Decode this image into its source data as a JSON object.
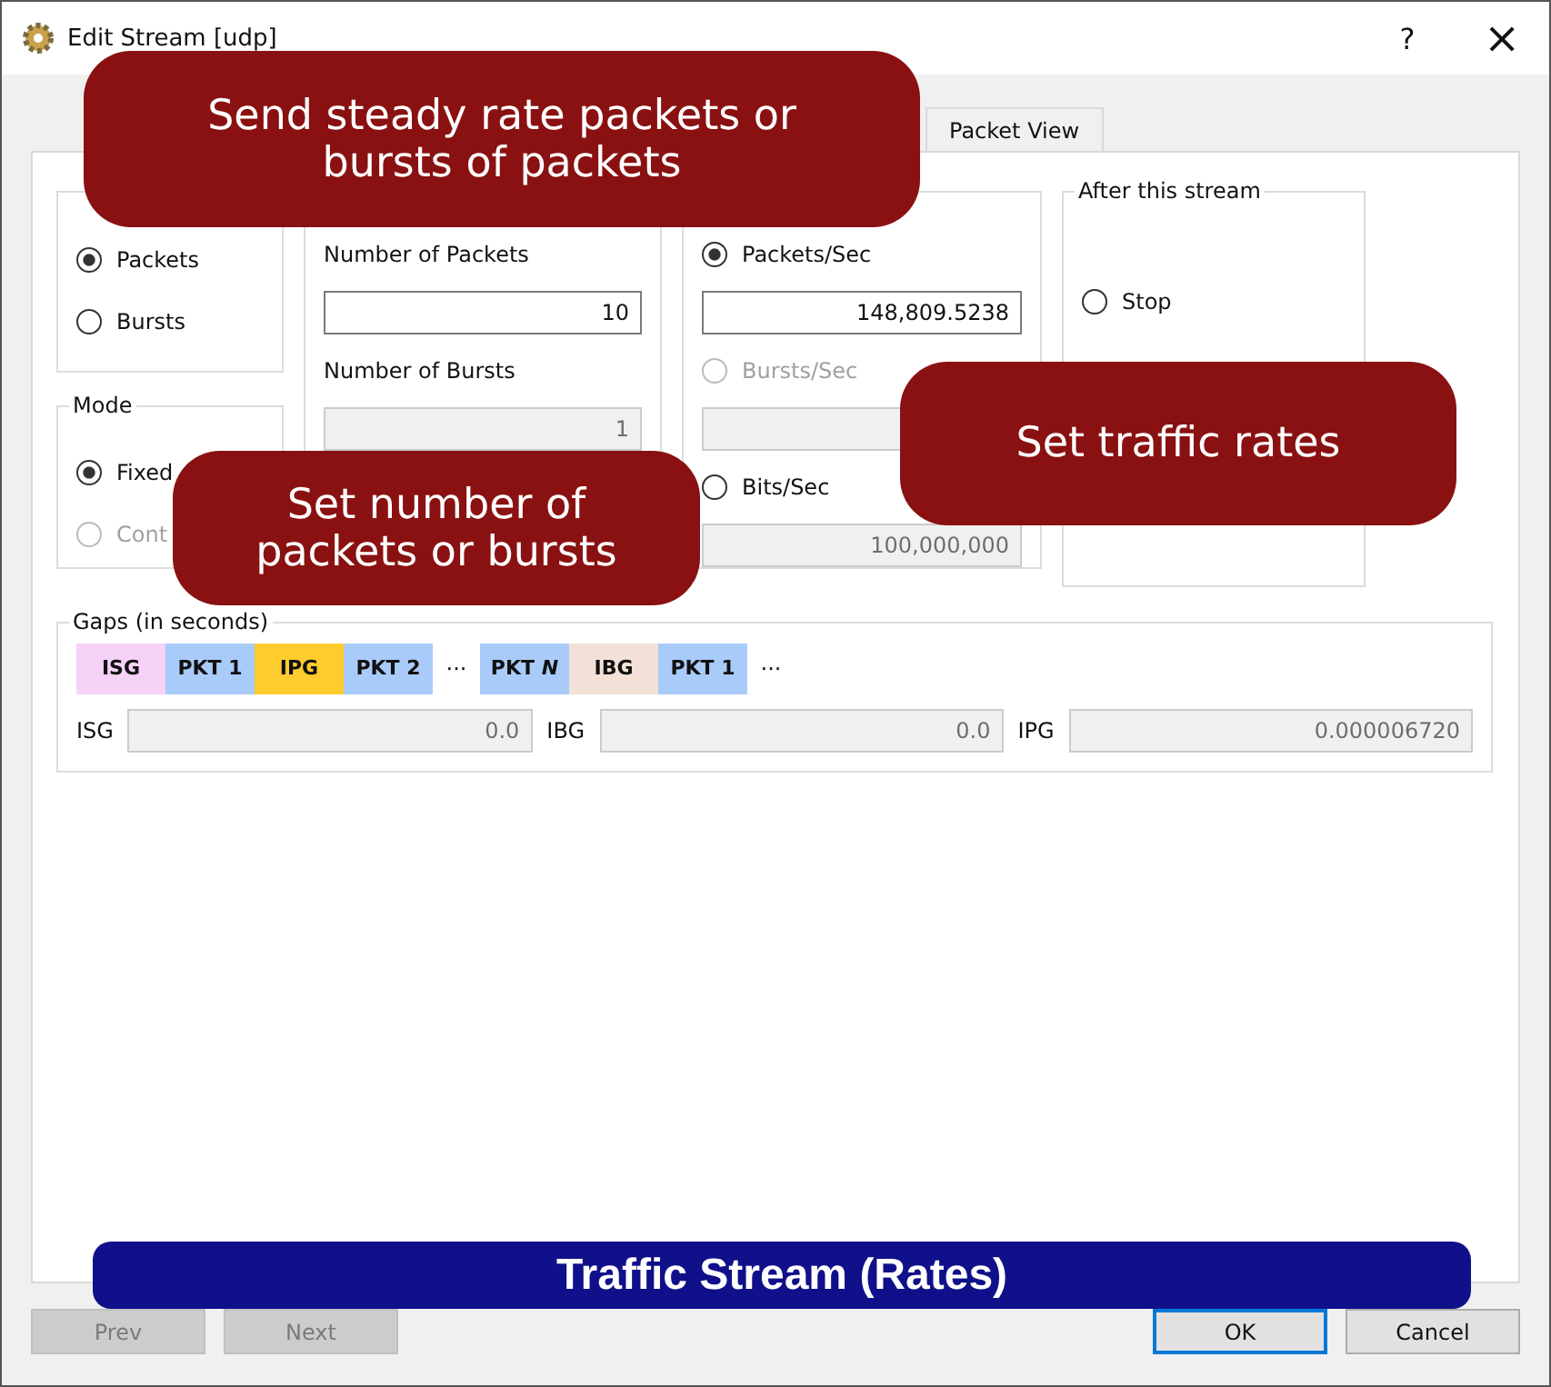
{
  "window": {
    "title": "Edit Stream [udp]",
    "help": "?",
    "close": "×"
  },
  "tabs": [
    {
      "label": "Packet View",
      "selected": false
    }
  ],
  "send": {
    "options": [
      {
        "label": "Packets",
        "selected": true,
        "disabled": false
      },
      {
        "label": "Bursts",
        "selected": false,
        "disabled": false
      }
    ]
  },
  "mode": {
    "title": "Mode",
    "options": [
      {
        "label": "Fixed",
        "selected": true,
        "disabled": false
      },
      {
        "label": "Cont",
        "selected": false,
        "disabled": true
      }
    ]
  },
  "numbers": {
    "fields": [
      {
        "label": "Number of Packets",
        "value": "10",
        "disabled": false
      },
      {
        "label": "Number of Bursts",
        "value": "1",
        "disabled": true
      }
    ]
  },
  "rate": {
    "options": [
      {
        "label": "Packets/Sec",
        "selected": true,
        "disabled": false,
        "value": "148,809.5238",
        "field_disabled": false
      },
      {
        "label": "Bursts/Sec",
        "selected": false,
        "disabled": true,
        "field_disabled": true
      },
      {
        "label": "Bits/Sec",
        "selected": false,
        "disabled": false,
        "value": "100,000,000",
        "field_disabled": true
      }
    ]
  },
  "after": {
    "title": "After this stream",
    "options": [
      {
        "label": "Stop",
        "selected": false,
        "disabled": false
      }
    ]
  },
  "gaps": {
    "title": "Gaps (in seconds)",
    "segments": [
      {
        "kind": "block",
        "label": "ISG",
        "color": "#f6d2f8"
      },
      {
        "kind": "block",
        "label": "PKT 1",
        "color": "#a9cbfa"
      },
      {
        "kind": "block",
        "label": "IPG",
        "color": "#ffcc2e"
      },
      {
        "kind": "block",
        "label": "PKT 2",
        "color": "#a9cbfa"
      },
      {
        "kind": "dots",
        "label": "···"
      },
      {
        "kind": "block",
        "label": "PKT *N*",
        "color": "#a9cbfa"
      },
      {
        "kind": "block",
        "label": "IBG",
        "color": "#f3e1d7"
      },
      {
        "kind": "block",
        "label": "PKT 1",
        "color": "#a9cbfa"
      },
      {
        "kind": "dots",
        "label": "···"
      }
    ],
    "fields": [
      {
        "label": "ISG",
        "value": "0.0"
      },
      {
        "label": "IBG",
        "value": "0.0"
      },
      {
        "label": "IPG",
        "value": "0.000006720"
      }
    ]
  },
  "buttons": [
    {
      "label": "Prev",
      "disabled": true,
      "default": false
    },
    {
      "label": "Next",
      "disabled": true,
      "default": false
    },
    {
      "label": "OK",
      "disabled": false,
      "default": true
    },
    {
      "label": "Cancel",
      "disabled": false,
      "default": false
    }
  ],
  "callouts": [
    {
      "kind": "tip",
      "text": "Send steady rate packets or bursts of packets"
    },
    {
      "kind": "tip",
      "text": "Set number of packets or bursts"
    },
    {
      "kind": "tip",
      "text": "Set traffic rates"
    },
    {
      "kind": "banner",
      "text": "Traffic Stream (Rates)"
    }
  ]
}
